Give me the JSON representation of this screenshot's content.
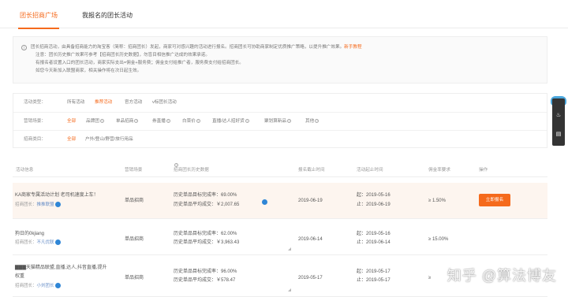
{
  "tabs": [
    {
      "label": "团长招商广场"
    },
    {
      "label": "我报名的团长活动"
    }
  ],
  "notice": {
    "line1": "团长招商活动，由具备招商能力的淘宝客（简称：招商团长）发起，商家可对感兴趣的活动进行报名。招商团长可协助商家制定优质推广策略，以提升推广效果。",
    "link": "新手教程",
    "line2": "注意：团长历史推广效果可参考【招商团长历史数据】，勿盲目相信推广达成的效果承诺。",
    "line3": "有报名者设置入口的团长活动，商家实际支出=佣金+服务费；佣金支付给推广者，服务费支付给招商团长。",
    "line4": "如您今天新加入联盟商家，相关操作将在次日起生效。"
  },
  "filters": {
    "activity_type": {
      "label": "活动类型：",
      "options": [
        "所有活动",
        "推荐活动",
        "官方活动",
        "v标团长活动"
      ],
      "selected": 1
    },
    "scene": {
      "label": "营销场景：",
      "options": [
        "全部",
        "品牌团",
        "单品招商",
        "券直播",
        "白菜价",
        "直播/达人招好货",
        "聚划算新品",
        "其他"
      ],
      "selected": 0
    },
    "category": {
      "label": "招商类目：",
      "options": [
        "全部",
        "户外/登山/野营/旅行用品"
      ],
      "selected": 0
    }
  },
  "table": {
    "headers": [
      "活动信息",
      "营销场景",
      "招商团长历史数据",
      "报名截止时间",
      "活动起止时间",
      "佣金率要求",
      "操作"
    ],
    "rows": [
      {
        "title": "KA商家专属活动计划 老司机速度上车！",
        "leader_label": "招商团长：",
        "leader": "推推联盟",
        "scene": "单品招商",
        "rate_text": "历史单品目标完成率：69.00%",
        "avg_text": "历史单品平均成交：￥2,007.65",
        "deadline": "2019-06-19",
        "start": "起：2019-05-16",
        "end": "止：2019-06-19",
        "commission": "≥ 1.50%",
        "action": "立即报名"
      },
      {
        "title": "狗日的0kjiang",
        "leader_label": "招商团长：",
        "leader": "不凡优联",
        "scene": "单品招商",
        "rate_text": "历史单品目标完成率：62.00%",
        "avg_text": "历史单品平均成交：￥3,963.43",
        "deadline": "2019-06-14",
        "start": "起：2019-05-16",
        "end": "止：2019-06-14",
        "commission": "≥ 15.00%",
        "action": ""
      },
      {
        "title": "▇▇▇天猫精品联盟,直播,达人,抖音直播,提升",
        "title2": "权重",
        "leader_label": "招商团长：",
        "leader": "小刘团长",
        "scene": "单品招商",
        "rate_text": "历史单品目标完成率：96.00%",
        "avg_text": "历史单品平均成交：￥578.47",
        "deadline": "2019-05-17",
        "start": "起：2019-05-17",
        "end": "止：2019-05-17",
        "commission": "≥",
        "action": ""
      }
    ]
  },
  "side_panel": {
    "icons": [
      "bell-icon",
      "chat-icon"
    ]
  },
  "watermark": "知乎 @算法博友",
  "colors": {
    "accent": "#f56a1c",
    "highlight_row": "#fdf5ef",
    "link_blue": "#2f86d6"
  }
}
